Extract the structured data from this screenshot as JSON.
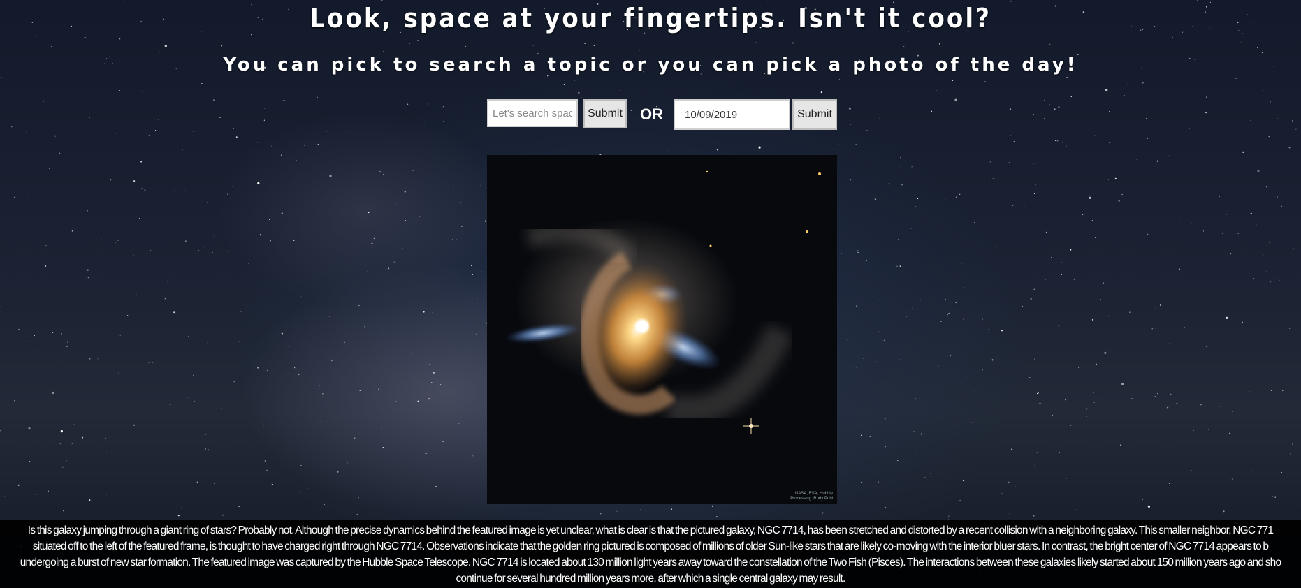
{
  "header": {
    "title": "Look, space at your fingertips. Isn't it cool?",
    "subtitle": "You can pick to search a topic or you can pick a photo of the day!"
  },
  "search": {
    "placeholder": "Let's search space!",
    "value": "",
    "submit_label": "Submit"
  },
  "separator": "OR",
  "date_picker": {
    "value": "10/09/2019",
    "submit_label": "Submit"
  },
  "apod": {
    "image_subject": "spiral galaxy NGC 7714",
    "credit_line1": "NASA, ESA, Hubble",
    "credit_line2": "Processing: Rudy Pohl"
  },
  "explanation": {
    "line1": "Is this galaxy jumping through a giant ring of stars? Probably not. Although the precise dynamics behind the featured image is yet unclear, what is clear is that the pictured galaxy, NGC 7714, has been stretched and distorted by a recent collision with a neighboring galaxy. This smaller neighbor, NGC 771",
    "line2": "situated off to the left of the featured frame, is thought to have charged right through NGC 7714. Observations indicate that the golden ring pictured is composed of millions of older Sun-like stars that are likely co-moving with the interior bluer stars. In contrast, the bright center of NGC 7714 appears to b",
    "line3": "undergoing a burst of new star formation. The featured image was captured by the Hubble Space Telescope. NGC 7714 is located about 130 million light years away toward the constellation of the Two Fish (Pisces). The interactions between these galaxies likely started about 150 million years ago and sho",
    "line4": "continue for several hundred million years more, after which a single central galaxy may result."
  },
  "colors": {
    "background": "#121a2b",
    "text": "#ffffff",
    "button": "#e6e6e6",
    "caption_bg": "#000000"
  }
}
